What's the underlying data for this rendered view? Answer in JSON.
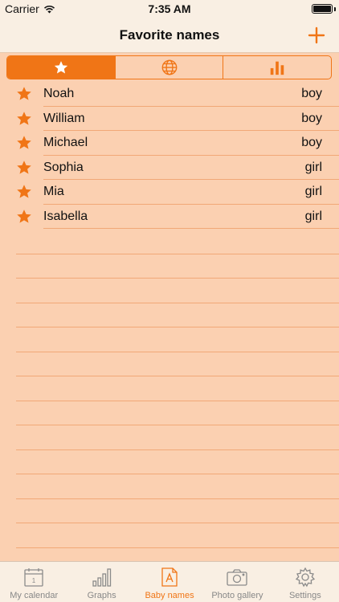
{
  "status_bar": {
    "carrier": "Carrier",
    "time": "7:35 AM"
  },
  "nav": {
    "title": "Favorite names",
    "add_icon": "plus-icon"
  },
  "segments": [
    {
      "icon": "star-icon",
      "active": true
    },
    {
      "icon": "globe-icon",
      "active": false
    },
    {
      "icon": "bar-chart-icon",
      "active": false
    }
  ],
  "names": [
    {
      "name": "Noah",
      "gender": "boy"
    },
    {
      "name": "William",
      "gender": "boy"
    },
    {
      "name": "Michael",
      "gender": "boy"
    },
    {
      "name": "Sophia",
      "gender": "girl"
    },
    {
      "name": "Mia",
      "gender": "girl"
    },
    {
      "name": "Isabella",
      "gender": "girl"
    }
  ],
  "tabs": [
    {
      "label": "My calendar",
      "icon": "calendar-icon",
      "active": false
    },
    {
      "label": "Graphs",
      "icon": "graph-icon",
      "active": false
    },
    {
      "label": "Baby names",
      "icon": "baby-names-icon",
      "active": true
    },
    {
      "label": "Photo gallery",
      "icon": "camera-icon",
      "active": false
    },
    {
      "label": "Settings",
      "icon": "gear-icon",
      "active": false
    }
  ],
  "colors": {
    "accent": "#f07516",
    "background": "#fbd0b1",
    "bar": "#f9efe3",
    "rule": "#f1a877"
  }
}
